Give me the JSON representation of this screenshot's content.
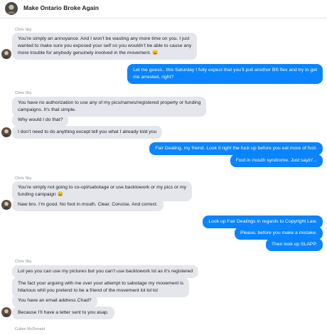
{
  "header": {
    "title": "Make Ontario Broke Again"
  },
  "thread": {
    "s1": {
      "sender": "Chris Sky",
      "m1": [
        "You’re simply an annoyance. And I won’t be wasting any more time on you. I just",
        "wanted to make sure you exposed your self so you wouldn’t be able to cause any",
        "more trouble for anybody genuinely involved in the movement. 😀"
      ]
    },
    "o1": [
      "Let me guess.. this Saturday I fully expect that you’ll pull another BS flex and try to get",
      "me arrested, right?"
    ],
    "s2": {
      "sender": "Chris Sky",
      "m1": [
        "You have no authorization to use any of my pics/names/registered property or funding",
        "campaigns.   It’s that simple."
      ],
      "m2": "Why would I do that?",
      "m3": "I don’t need to do anything except tell you what I already told you"
    },
    "o2": {
      "m1": "Fair Dealing, my friend. Look it right the fuck up before you eat more of foot.",
      "m2": "Foot in mouth syndrome. Just sayin'..."
    },
    "s3": {
      "sender": "Chris Sky",
      "m1": [
        "You’re simply not going to co-opt/sabotage or use backtowork or my pics or my",
        "funding campaign 😀"
      ],
      "m2": "Naw bro. I’m good. No foot in mouth. Clear. Concise. And correct."
    },
    "o3": {
      "m1": "Look up Fair Dealings in regards to Copyright Law.",
      "m2": "Please, before you make a mistake.",
      "m3": "Then look up SLAPP."
    },
    "s4": {
      "sender": "Chris Sky",
      "m1": "Lol yes you can use my pictures but you can’t use backtowork lol as it’s registered",
      "m2": [
        "The fact your arguing with me over your attempt to sabotage my movement is",
        "hilarious whil you pretend to be a friend of the movement lol lol lol"
      ],
      "m3": "You have an email address Chad?",
      "m4": "Because I’ll have a letter sent to you asap."
    },
    "s5": {
      "sender": "Cullen McDonald"
    }
  }
}
